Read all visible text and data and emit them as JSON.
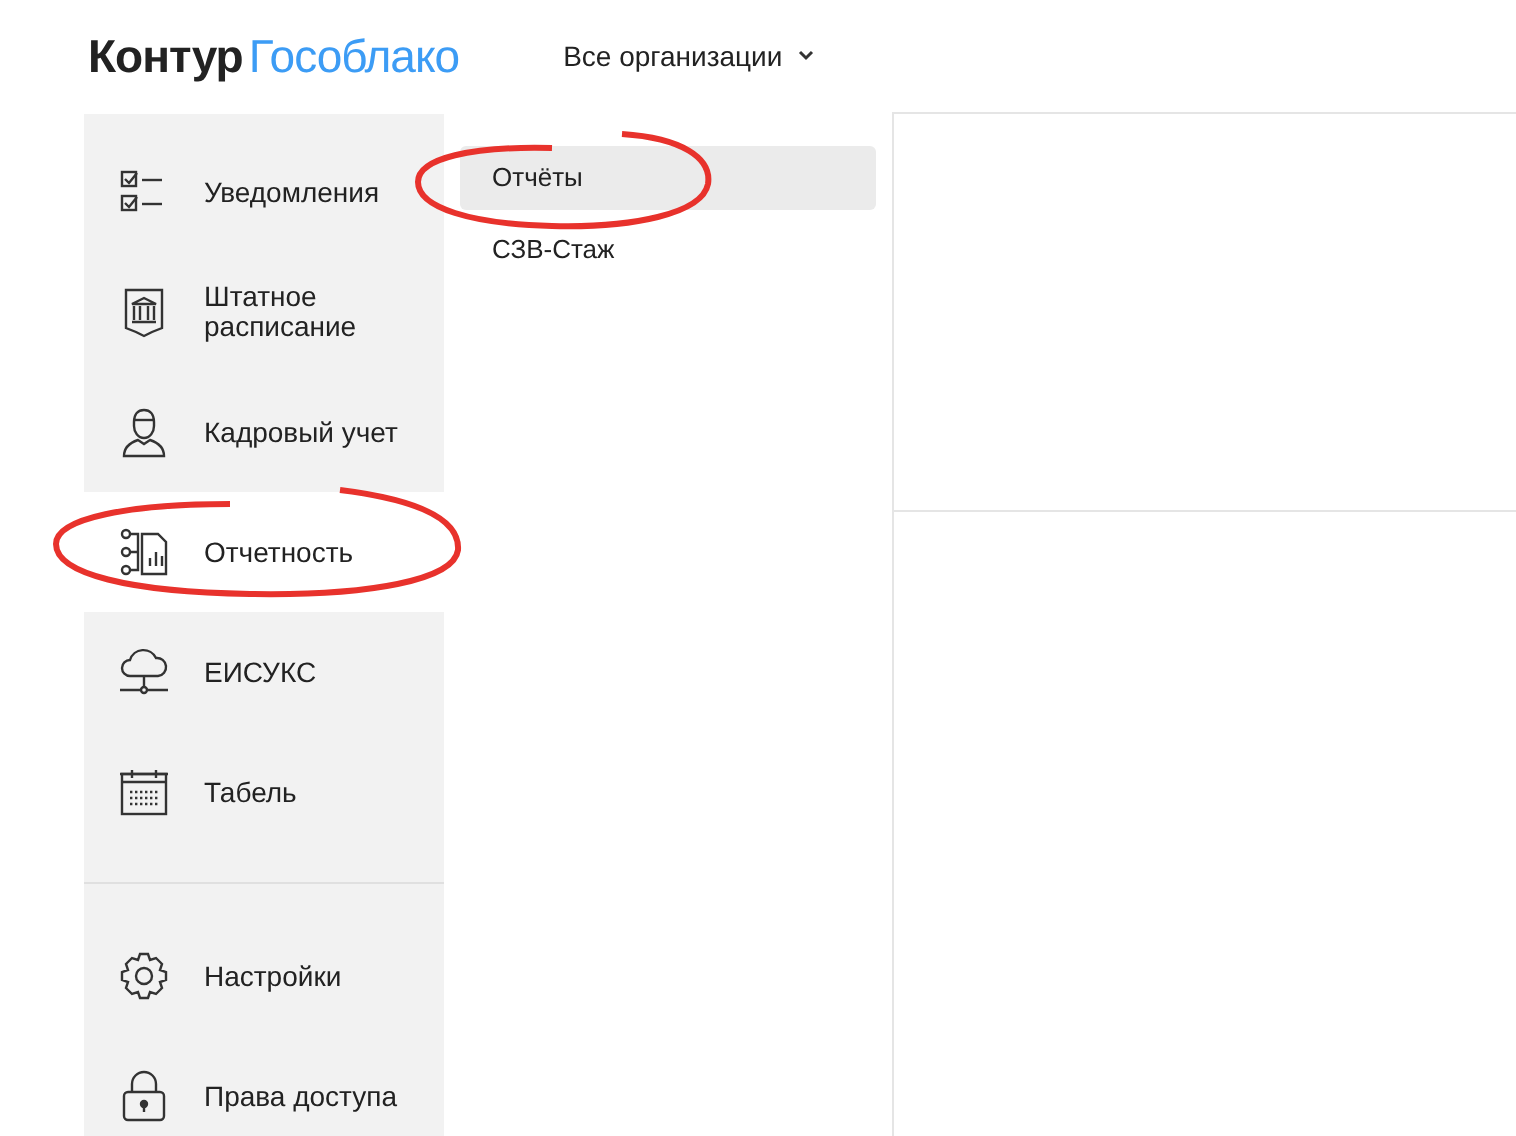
{
  "header": {
    "logo_primary": "Контур",
    "logo_secondary": "Гособлако",
    "org_selector": "Все организации"
  },
  "sidebar": {
    "groups": [
      {
        "items": [
          {
            "label": "Уведомления",
            "selected": false
          },
          {
            "label": "Штатное\nрасписание",
            "selected": false
          },
          {
            "label": "Кадровый учет",
            "selected": false
          },
          {
            "label": "Отчетность",
            "selected": true
          },
          {
            "label": "ЕИСУКС",
            "selected": false
          },
          {
            "label": "Табель",
            "selected": false
          }
        ]
      },
      {
        "items": [
          {
            "label": "Настройки",
            "selected": false
          },
          {
            "label": "Права доступа",
            "selected": false
          }
        ]
      }
    ]
  },
  "submenu": {
    "items": [
      {
        "label": "Отчёты",
        "selected": true
      },
      {
        "label": "СЗВ-Стаж",
        "selected": false
      }
    ]
  }
}
